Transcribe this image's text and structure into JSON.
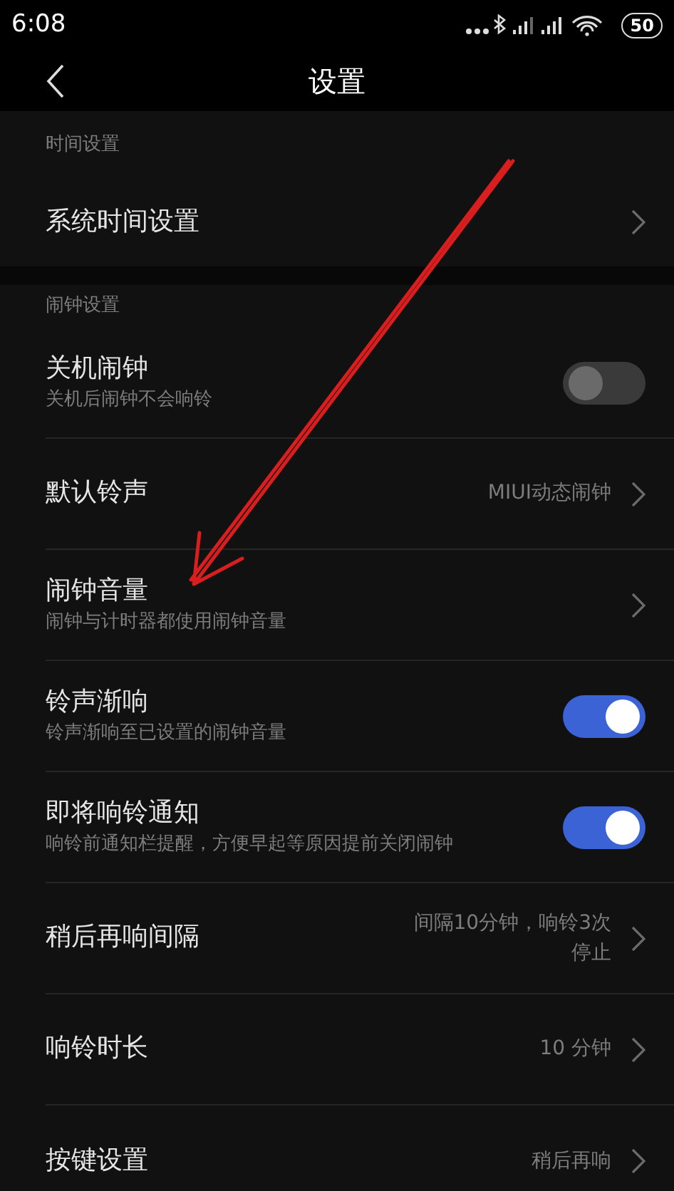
{
  "status_bar": {
    "time": "6:08",
    "battery": "50"
  },
  "header": {
    "title": "设置"
  },
  "sections": [
    {
      "header": "时间设置",
      "items": [
        {
          "kind": "link",
          "title": "系统时间设置"
        }
      ]
    },
    {
      "header": "闹钟设置",
      "items": [
        {
          "kind": "toggle",
          "title": "关机闹钟",
          "subtitle": "关机后闹钟不会响铃",
          "on": false
        },
        {
          "kind": "link",
          "title": "默认铃声",
          "value": "MIUI动态闹钟"
        },
        {
          "kind": "link",
          "title": "闹钟音量",
          "subtitle": "闹钟与计时器都使用闹钟音量"
        },
        {
          "kind": "toggle",
          "title": "铃声渐响",
          "subtitle": "铃声渐响至已设置的闹钟音量",
          "on": true
        },
        {
          "kind": "toggle",
          "title": "即将响铃通知",
          "subtitle": "响铃前通知栏提醒，方便早起等原因提前关闭闹钟",
          "on": true
        },
        {
          "kind": "link",
          "title": "稍后再响间隔",
          "value_lines": [
            "间隔10分钟，响铃3次",
            "停止"
          ]
        },
        {
          "kind": "link",
          "title": "响铃时长",
          "value": "10 分钟"
        },
        {
          "kind": "link",
          "title": "按键设置",
          "value": "稍后再响"
        }
      ]
    }
  ]
}
